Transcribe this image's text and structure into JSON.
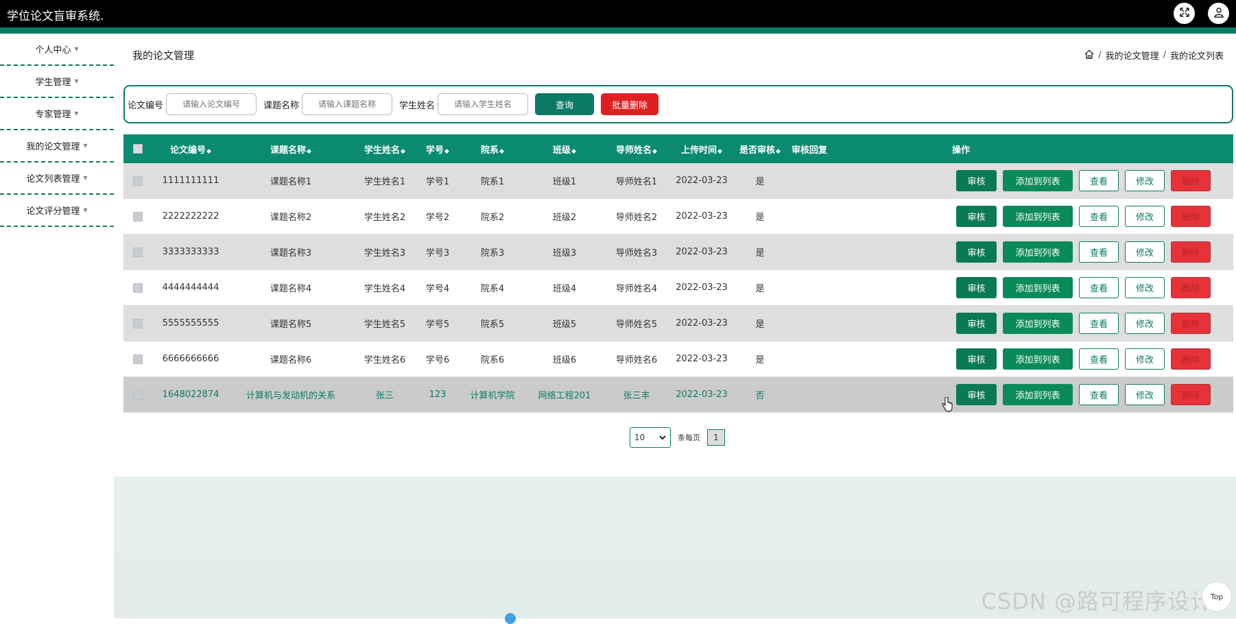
{
  "header": {
    "app_title": "学位论文盲审系统."
  },
  "sidebar": {
    "items": [
      {
        "label": "个人中心"
      },
      {
        "label": "学生管理"
      },
      {
        "label": "专家管理"
      },
      {
        "label": "我的论文管理"
      },
      {
        "label": "论文列表管理"
      },
      {
        "label": "论文评分管理"
      }
    ]
  },
  "page": {
    "title": "我的论文管理",
    "breadcrumb": [
      "我的论文管理",
      "我的论文列表"
    ]
  },
  "search": {
    "fields": [
      {
        "label": "论文编号",
        "placeholder": "请输入论文编号"
      },
      {
        "label": "课题名称",
        "placeholder": "请输入课题名称"
      },
      {
        "label": "学生姓名",
        "placeholder": "请输入学生姓名"
      }
    ],
    "query_label": "查询",
    "batch_delete_label": "批量删除"
  },
  "table": {
    "headers": [
      "论文编号",
      "课题名称",
      "学生姓名",
      "学号",
      "院系",
      "班级",
      "导师姓名",
      "上传时间",
      "是否审核",
      "审核回复",
      "操作"
    ],
    "sort_glyph": "◆",
    "rows": [
      {
        "id": "1111111111",
        "topic": "课题名称1",
        "student": "学生姓名1",
        "sno": "学号1",
        "dept": "院系1",
        "cls": "班级1",
        "tutor": "导师姓名1",
        "time": "2022-03-23",
        "reviewed": "是",
        "reply": ""
      },
      {
        "id": "2222222222",
        "topic": "课题名称2",
        "student": "学生姓名2",
        "sno": "学号2",
        "dept": "院系2",
        "cls": "班级2",
        "tutor": "导师姓名2",
        "time": "2022-03-23",
        "reviewed": "是",
        "reply": ""
      },
      {
        "id": "3333333333",
        "topic": "课题名称3",
        "student": "学生姓名3",
        "sno": "学号3",
        "dept": "院系3",
        "cls": "班级3",
        "tutor": "导师姓名3",
        "time": "2022-03-23",
        "reviewed": "是",
        "reply": ""
      },
      {
        "id": "4444444444",
        "topic": "课题名称4",
        "student": "学生姓名4",
        "sno": "学号4",
        "dept": "院系4",
        "cls": "班级4",
        "tutor": "导师姓名4",
        "time": "2022-03-23",
        "reviewed": "是",
        "reply": ""
      },
      {
        "id": "5555555555",
        "topic": "课题名称5",
        "student": "学生姓名5",
        "sno": "学号5",
        "dept": "院系5",
        "cls": "班级5",
        "tutor": "导师姓名5",
        "time": "2022-03-23",
        "reviewed": "是",
        "reply": ""
      },
      {
        "id": "6666666666",
        "topic": "课题名称6",
        "student": "学生姓名6",
        "sno": "学号6",
        "dept": "院系6",
        "cls": "班级6",
        "tutor": "导师姓名6",
        "time": "2022-03-23",
        "reviewed": "是",
        "reply": ""
      },
      {
        "id": "1648022874",
        "topic": "计算机与发动机的关系",
        "student": "张三",
        "sno": "123",
        "dept": "计算机学院",
        "cls": "网络工程201",
        "tutor": "张三丰",
        "time": "2022-03-23",
        "reviewed": "否",
        "reply": ""
      }
    ],
    "actions": {
      "review": "审核",
      "add": "添加到列表",
      "view": "查看",
      "edit": "修改",
      "delete": "删除"
    }
  },
  "pagination": {
    "page_size": "10",
    "per_page_label": "条每页",
    "current_page": "1"
  },
  "misc": {
    "watermark": "CSDN @路可程序设计",
    "top_label": "Top"
  },
  "colors": {
    "accent": "#0a7a66",
    "danger": "#e8323a",
    "header_bg": "#000000"
  }
}
